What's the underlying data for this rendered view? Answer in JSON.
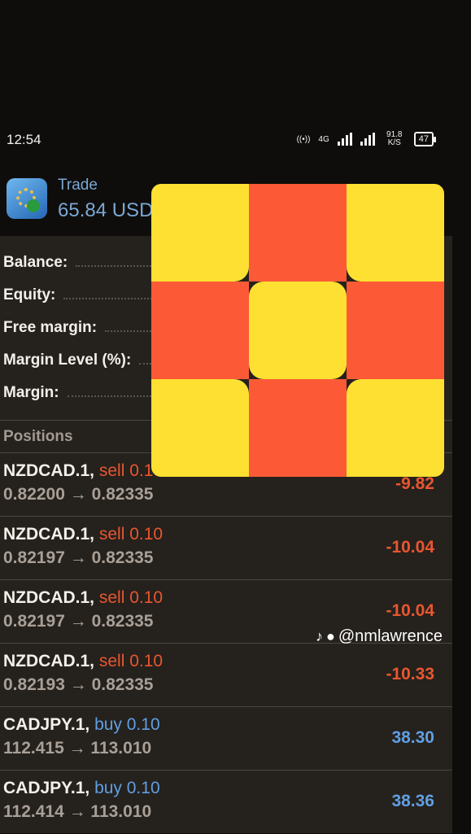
{
  "status_bar": {
    "time": "12:54",
    "network": "4G",
    "speed": "91.8 K/S",
    "battery": "47"
  },
  "header": {
    "title": "Trade",
    "value": "65.84 USD"
  },
  "summary": {
    "labels": [
      "Balance:",
      "Equity:",
      "Free margin:",
      "Margin Level (%):",
      "Margin:"
    ]
  },
  "positions": {
    "header": "Positions",
    "rows": [
      {
        "symbol": "NZDCAD.1,",
        "side": "sell 0.10",
        "side_type": "sell",
        "prices": "0.82200 → 0.82335",
        "profit": "-9.82"
      },
      {
        "symbol": "NZDCAD.1,",
        "side": "sell 0.10",
        "side_type": "sell",
        "prices": "0.82197 → 0.82335",
        "profit": "-10.04"
      },
      {
        "symbol": "NZDCAD.1,",
        "side": "sell 0.10",
        "side_type": "sell",
        "prices": "0.82197 → 0.82335",
        "profit": "-10.04"
      },
      {
        "symbol": "NZDCAD.1,",
        "side": "sell 0.10",
        "side_type": "sell",
        "prices": "0.82193 → 0.82335",
        "profit": "-10.33"
      },
      {
        "symbol": "CADJPY.1,",
        "side": "buy 0.10",
        "side_type": "buy",
        "prices": "112.415 → 113.010",
        "profit": "38.30"
      },
      {
        "symbol": "CADJPY.1,",
        "side": "buy 0.10",
        "side_type": "buy",
        "prices": "112.414 → 113.010",
        "profit": "38.36"
      }
    ]
  },
  "watermark": {
    "handle": "@nmlawrence"
  },
  "colors": {
    "sell": "#e9562f",
    "buy": "#5f9fe3",
    "overlay_yellow": "#fde032",
    "overlay_red": "#fc5a36"
  }
}
